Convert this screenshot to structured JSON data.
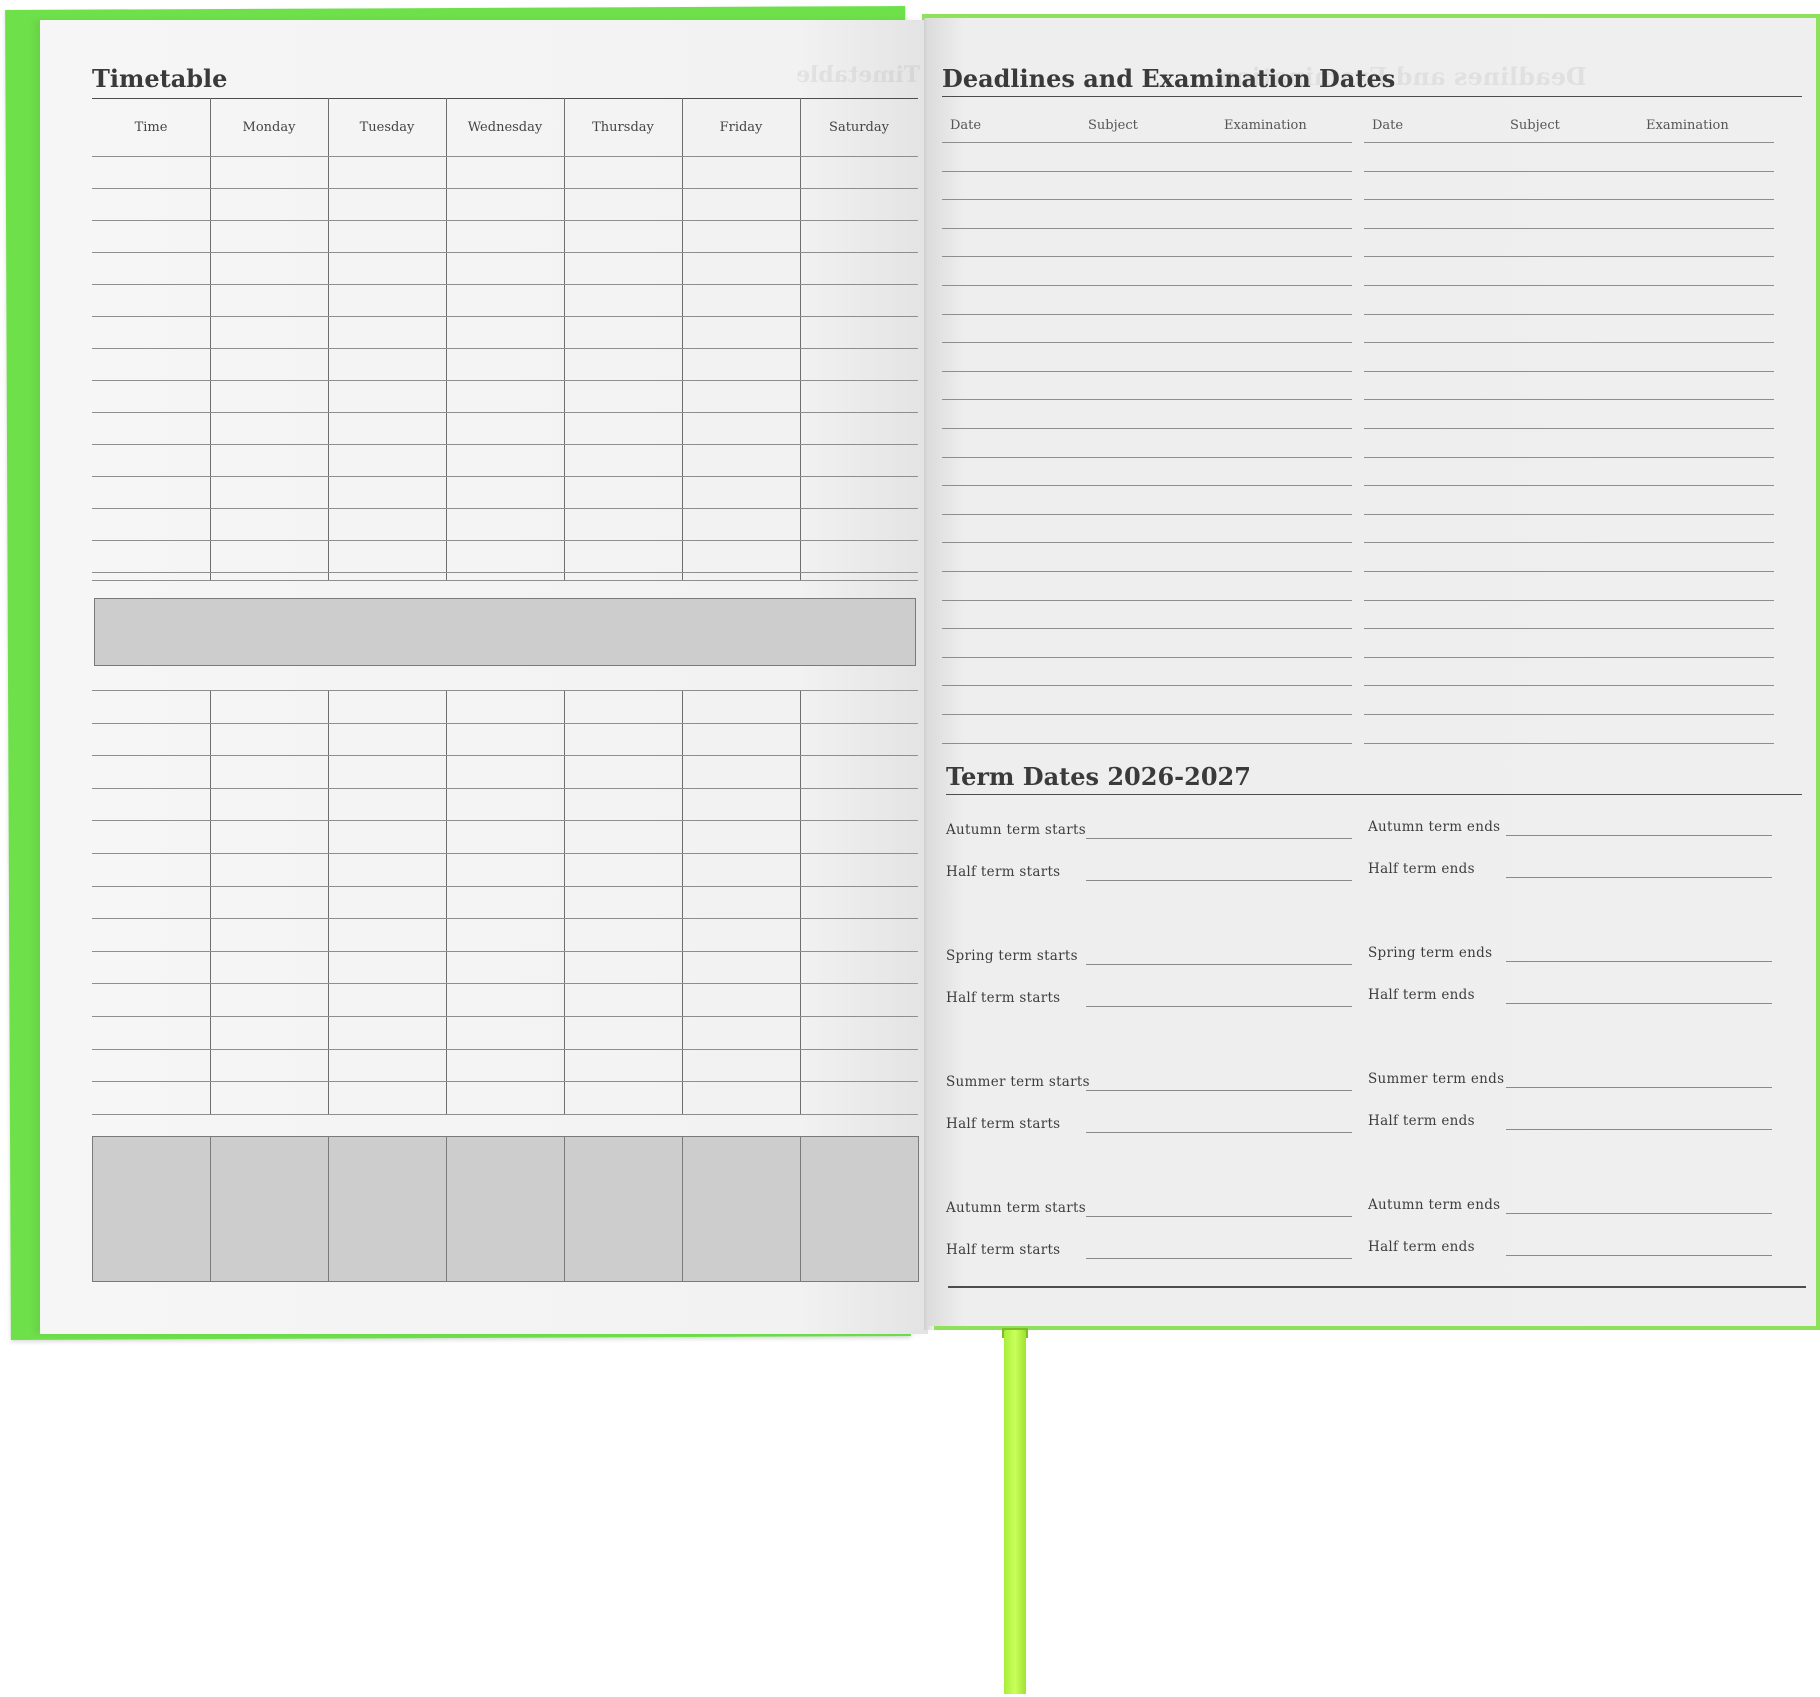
{
  "left_page": {
    "title": "Timetable",
    "columns": [
      "Time",
      "Monday",
      "Tuesday",
      "Wednesday",
      "Thursday",
      "Friday",
      "Saturday"
    ]
  },
  "right_page": {
    "deadlines_title": "Deadlines and Examination Dates",
    "deadline_columns": [
      "Date",
      "Subject",
      "Examination",
      "Date",
      "Subject",
      "Examination"
    ],
    "term_title": "Term Dates 2026-2027",
    "term_rows": [
      [
        "Autumn term starts",
        "Autumn term ends"
      ],
      [
        "Half term starts",
        "Half term ends"
      ],
      [
        "Spring term starts",
        "Spring term ends"
      ],
      [
        "Half term starts",
        "Half term ends"
      ],
      [
        "Summer term starts",
        "Summer term ends"
      ],
      [
        "Half term starts",
        "Half term ends"
      ],
      [
        "Autumn term starts",
        "Autumn term ends"
      ],
      [
        "Half term starts",
        "Half term ends"
      ]
    ]
  },
  "colors": {
    "cover": "#6ee04a",
    "ribbon": "#b8f84a",
    "page": "#f1f1f1",
    "grey_block": "#cdcdcd"
  }
}
